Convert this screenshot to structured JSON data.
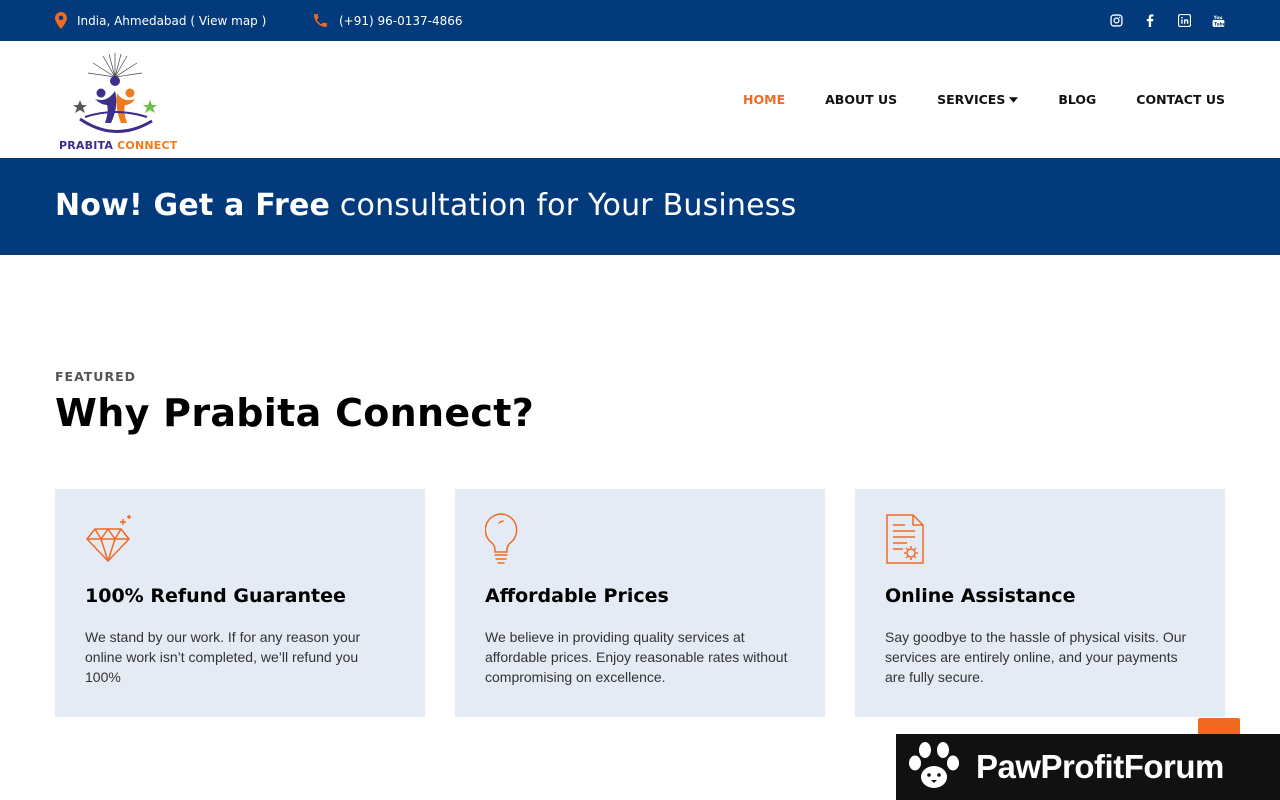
{
  "topbar": {
    "location": "India, Ahmedabad ( View map )",
    "phone": "(+91) 96-0137-4866",
    "social": [
      "instagram-icon",
      "facebook-icon",
      "linkedin-icon",
      "youtube-icon"
    ]
  },
  "logo": {
    "part1": "PRABITA",
    "part2": "CONNECT"
  },
  "nav": {
    "home": "HOME",
    "about": "ABOUT US",
    "services": "SERVICES",
    "blog": "BLOG",
    "contact": "CONTACT US"
  },
  "banner": {
    "bold": "Now! Get a Free",
    "rest": " consultation for Your Business"
  },
  "featured": {
    "eyebrow": "FEATURED",
    "title": "Why Prabita Connect?",
    "cards": [
      {
        "icon": "diamond-icon",
        "title": "100% Refund Guarantee",
        "text": "We stand by our work. If for any reason your online work isn’t completed, we’ll refund you 100%"
      },
      {
        "icon": "lightbulb-icon",
        "title": "Affordable Prices",
        "text": "We believe in providing quality services at affordable prices. Enjoy reasonable rates without compromising on excellence."
      },
      {
        "icon": "document-gear-icon",
        "title": "Online Assistance",
        "text": "Say goodbye to the hassle of physical visits. Our services are entirely online, and your payments are fully secure."
      }
    ]
  },
  "watermark": {
    "text": "PawProfitForum"
  },
  "colors": {
    "brand_blue": "#033a7c",
    "accent_orange": "#f06a22",
    "card_bg": "#e4ebf4"
  }
}
